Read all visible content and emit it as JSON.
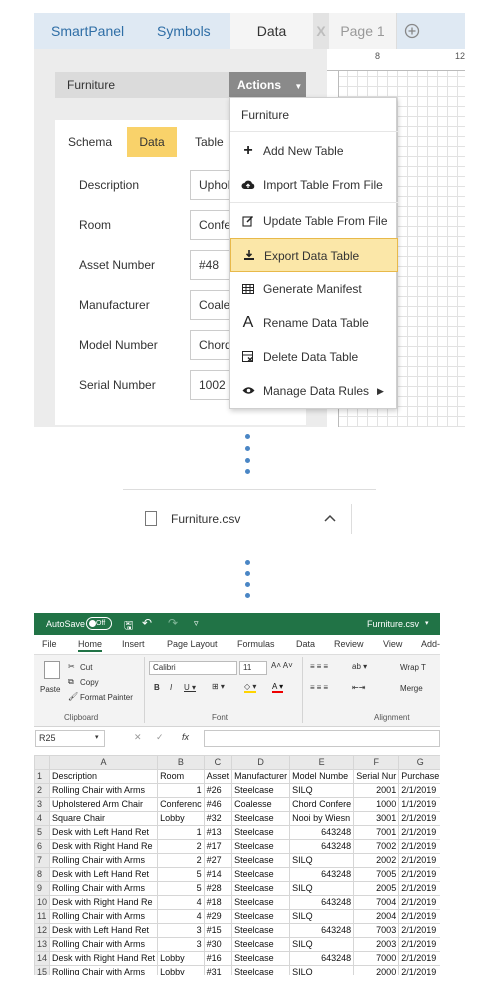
{
  "panel": {
    "tabs": [
      "SmartPanel",
      "Symbols",
      "Data"
    ],
    "close_tab": "X",
    "page_tab": "Page 1",
    "add_page_icon": "plus-circle-icon",
    "ruler_ticks": [
      "8",
      "12"
    ],
    "dataset": "Furniture",
    "actions_label": "Actions",
    "subtabs": [
      "Schema",
      "Data",
      "Table"
    ],
    "fields": [
      {
        "label": "Description",
        "value": "Uphol"
      },
      {
        "label": "Room",
        "value": "Confe"
      },
      {
        "label": "Asset Number",
        "value": "#48"
      },
      {
        "label": "Manufacturer",
        "value": "Coales"
      },
      {
        "label": "Model Number",
        "value": "Chord"
      },
      {
        "label": "Serial Number",
        "value": "1002"
      }
    ],
    "accent": "#f9d26a"
  },
  "dropdown": {
    "header": "Furniture",
    "items": [
      {
        "icon": "plus-icon",
        "label": "Add New Table"
      },
      {
        "icon": "cloud-upload-icon",
        "label": "Import Table From File"
      },
      {
        "icon": "edit-icon",
        "label": "Update Table From File"
      },
      {
        "icon": "download-icon",
        "label": "Export Data Table",
        "highlighted": true
      },
      {
        "icon": "table-icon",
        "label": "Generate Manifest"
      },
      {
        "icon": "text-a-icon",
        "label": "Rename Data Table"
      },
      {
        "icon": "delete-table-icon",
        "label": "Delete Data Table"
      },
      {
        "icon": "eye-icon",
        "label": "Manage Data Rules"
      }
    ]
  },
  "download": {
    "file_name": "Furniture.csv"
  },
  "excel": {
    "autosave": "AutoSave",
    "autosave_state": "Off",
    "file_title": "Furniture.csv",
    "menu": [
      "File",
      "Home",
      "Insert",
      "Page Layout",
      "Formulas",
      "Data",
      "Review",
      "View",
      "Add-"
    ],
    "ribbon": {
      "cut": "Cut",
      "copy": "Copy",
      "paste": "Paste",
      "format_painter": "Format Painter",
      "clipboard": "Clipboard",
      "font_name": "Calibri",
      "font_size": "11",
      "font": "Font",
      "wrap": "Wrap T",
      "merge": "Merge",
      "alignment": "Alignment"
    },
    "name_box": "R25",
    "columns": [
      "A",
      "B",
      "C",
      "D",
      "E",
      "F",
      "G"
    ],
    "rows": [
      [
        "1",
        "Description",
        "Room",
        "Asset",
        "Manufacturer",
        "Model Numbe",
        "Serial Nur",
        "Purchase"
      ],
      [
        "2",
        "Rolling Chair with Arms",
        "1",
        "#26",
        "Steelcase",
        "SILQ",
        "2001",
        "2/1/2019"
      ],
      [
        "3",
        "Upholstered Arm Chair",
        "Conferenc",
        "#46",
        "Coalesse",
        "Chord Confere",
        "1000",
        "1/1/2019"
      ],
      [
        "4",
        "Square Chair",
        "Lobby",
        "#32",
        "Steelcase",
        "Nooi by Wiesn",
        "3001",
        "2/1/2019"
      ],
      [
        "5",
        "Desk with Left Hand Ret",
        "1",
        "#13",
        "Steelcase",
        "643248",
        "7001",
        "2/1/2019"
      ],
      [
        "6",
        "Desk with Right Hand Re",
        "2",
        "#17",
        "Steelcase",
        "643248",
        "7002",
        "2/1/2019"
      ],
      [
        "7",
        "Rolling Chair with Arms",
        "2",
        "#27",
        "Steelcase",
        "SILQ",
        "2002",
        "2/1/2019"
      ],
      [
        "8",
        "Desk with Left Hand Ret",
        "5",
        "#14",
        "Steelcase",
        "643248",
        "7005",
        "2/1/2019"
      ],
      [
        "9",
        "Rolling Chair with Arms",
        "5",
        "#28",
        "Steelcase",
        "SILQ",
        "2005",
        "2/1/2019"
      ],
      [
        "10",
        "Desk with Right Hand Re",
        "4",
        "#18",
        "Steelcase",
        "643248",
        "7004",
        "2/1/2019"
      ],
      [
        "11",
        "Rolling Chair with Arms",
        "4",
        "#29",
        "Steelcase",
        "SILQ",
        "2004",
        "2/1/2019"
      ],
      [
        "12",
        "Desk with Left Hand Ret",
        "3",
        "#15",
        "Steelcase",
        "643248",
        "7003",
        "2/1/2019"
      ],
      [
        "13",
        "Rolling Chair with Arms",
        "3",
        "#30",
        "Steelcase",
        "SILQ",
        "2003",
        "2/1/2019"
      ],
      [
        "14",
        "Desk with Right Hand Ret",
        "Lobby",
        "#16",
        "Steelcase",
        "643248",
        "7000",
        "2/1/2019"
      ],
      [
        "15",
        "Rolling Chair with Arms",
        "Lobby",
        "#31",
        "Steelcase",
        "SILQ",
        "2000",
        "2/1/2019"
      ]
    ],
    "brand": "#217346"
  }
}
